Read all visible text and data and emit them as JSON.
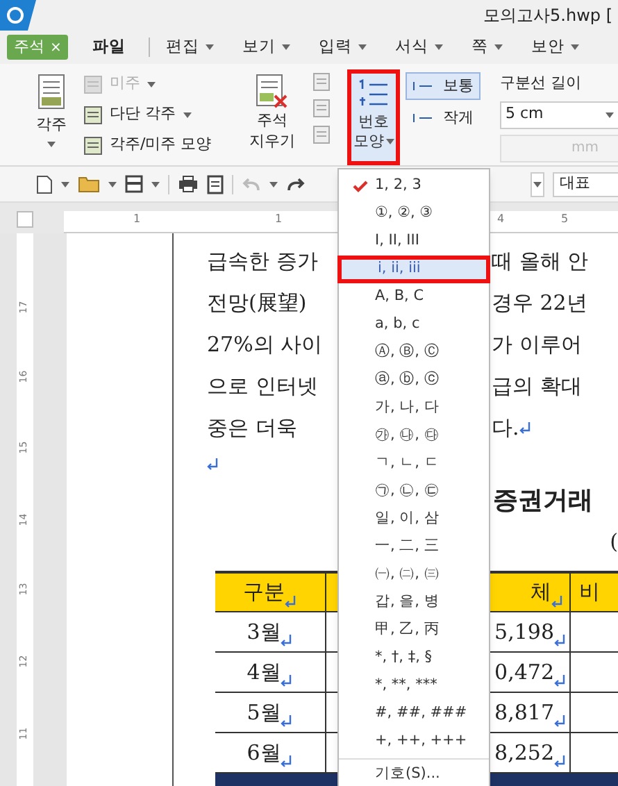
{
  "window": {
    "title": "모의고사5.hwp ["
  },
  "menu_bar": {
    "context_tab": {
      "label": "주석",
      "close": "×"
    },
    "items": [
      {
        "label": "파일",
        "dropdown": false
      },
      {
        "label": "편집",
        "dropdown": true
      },
      {
        "label": "보기",
        "dropdown": true
      },
      {
        "label": "입력",
        "dropdown": true
      },
      {
        "label": "서식",
        "dropdown": true
      },
      {
        "label": "쪽",
        "dropdown": true
      },
      {
        "label": "보안",
        "dropdown": true
      }
    ]
  },
  "ribbon": {
    "footnote": {
      "label": "각주"
    },
    "small_items": [
      {
        "label": "미주",
        "disabled": true,
        "dropdown": true
      },
      {
        "label": "다단 각주",
        "disabled": false,
        "dropdown": true
      },
      {
        "label": "각주/미주 모양",
        "disabled": false,
        "dropdown": false
      }
    ],
    "delete_note": {
      "label_lines": [
        "주석",
        "지우기"
      ]
    },
    "number_shape": {
      "label_lines": [
        "번호",
        "모양"
      ],
      "open": true
    },
    "sizes": [
      {
        "label": "보통",
        "selected": true
      },
      {
        "label": "작게",
        "selected": false
      }
    ],
    "separator": {
      "label": "구분선 길이",
      "length": "5 cm",
      "unit_placeholder": "mm"
    }
  },
  "toolbar": {
    "style_select": "대표"
  },
  "ruler": {
    "h_labels": [
      "1",
      "1",
      "4",
      "5"
    ],
    "v_labels": [
      "17",
      "16",
      "15",
      "14",
      "13",
      "12",
      "11"
    ]
  },
  "document": {
    "lines": [
      {
        "left": "급속한 증가",
        "right": "때 올해 안",
        "return": false
      },
      {
        "left": "전망(展望)",
        "right": "경우  22년",
        "return": false
      },
      {
        "left": "27%의 사이",
        "right": "가 이루어",
        "return": false
      },
      {
        "left": "으로 인터넷",
        "right": "급의 확대",
        "return": false
      },
      {
        "left": "중은 더욱",
        "right": "다.",
        "return": true
      }
    ],
    "empty_return": true,
    "table_title": "증권거래",
    "unit": "(",
    "table": {
      "header": {
        "column_1": "구분",
        "column_3": "체",
        "column_4": "비"
      },
      "rows": [
        {
          "column_1": "3월",
          "column_3": "5,198"
        },
        {
          "column_1": "4월",
          "column_3": "0,472"
        },
        {
          "column_1": "5월",
          "column_3": "8,817"
        },
        {
          "column_1": "6월",
          "column_3": "8,252"
        }
      ]
    }
  },
  "dropdown": {
    "items": [
      {
        "label": "1, 2, 3",
        "checked": true,
        "selected": false
      },
      {
        "label": "①, ②, ③",
        "checked": false,
        "selected": false
      },
      {
        "label": "I, II, III",
        "checked": false,
        "selected": false
      },
      {
        "label": "i, ii, iii",
        "checked": false,
        "selected": true
      },
      {
        "label": "A, B, C",
        "checked": false,
        "selected": false
      },
      {
        "label": "a, b, c",
        "checked": false,
        "selected": false
      },
      {
        "label": "Ⓐ, Ⓑ, Ⓒ",
        "checked": false,
        "selected": false
      },
      {
        "label": "ⓐ, ⓑ, ⓒ",
        "checked": false,
        "selected": false
      },
      {
        "label": "가, 나, 다",
        "checked": false,
        "selected": false
      },
      {
        "label": "㉮, ㉯, ㉰",
        "checked": false,
        "selected": false
      },
      {
        "label": "ㄱ, ㄴ, ㄷ",
        "checked": false,
        "selected": false
      },
      {
        "label": "㉠, ㉡, ㉢",
        "checked": false,
        "selected": false
      },
      {
        "label": "일, 이, 삼",
        "checked": false,
        "selected": false
      },
      {
        "label": "一, 二, 三",
        "checked": false,
        "selected": false
      },
      {
        "label": "㈠, ㈡, ㈢",
        "checked": false,
        "selected": false
      },
      {
        "label": "갑, 을, 병",
        "checked": false,
        "selected": false
      },
      {
        "label": "甲, 乙, 丙",
        "checked": false,
        "selected": false
      },
      {
        "label": "*, †, ‡, §",
        "checked": false,
        "selected": false
      },
      {
        "label": "*, **, ***",
        "checked": false,
        "selected": false
      },
      {
        "label": "#, ##, ###",
        "checked": false,
        "selected": false
      },
      {
        "label": "+, ++, +++",
        "checked": false,
        "selected": false
      }
    ],
    "footer": "기호(S)..."
  }
}
